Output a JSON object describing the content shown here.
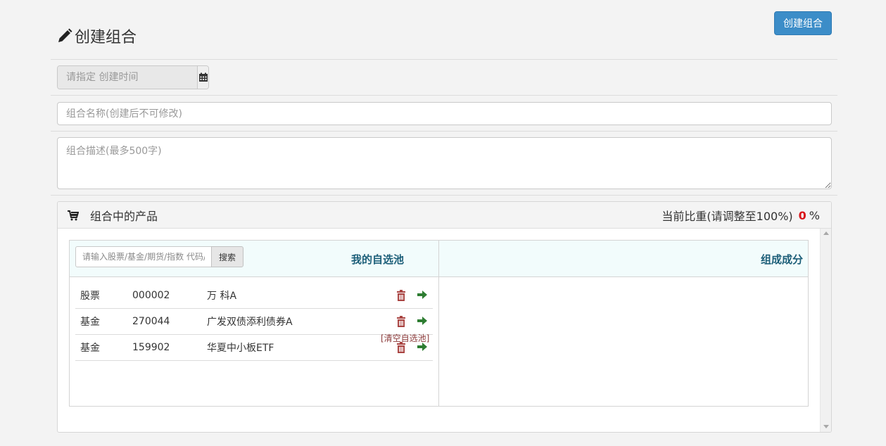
{
  "header": {
    "title": "创建组合",
    "create_button": "创建组合"
  },
  "form": {
    "date_placeholder": "请指定 创建时间",
    "name_placeholder": "组合名称(创建后不可修改)",
    "desc_placeholder": "组合描述(最多500字)"
  },
  "panel": {
    "title": "组合中的产品",
    "ratio_label": "当前比重(请调整至100%)",
    "ratio_value": "0",
    "ratio_unit": "%",
    "search_placeholder": "请输入股票/基金/期货/指数 代码/",
    "search_button": "搜索",
    "pool_title": "我的自选池",
    "composition_title": "组成成分",
    "clear_link": "[清空自选池]",
    "items": [
      {
        "type": "股票",
        "code": "000002",
        "name": "万 科A"
      },
      {
        "type": "基金",
        "code": "270044",
        "name": "广发双债添利债券A"
      },
      {
        "type": "基金",
        "code": "159902",
        "name": "华夏中小板ETF"
      }
    ]
  },
  "colors": {
    "primary_button": "#3c8dc8",
    "heading_teal": "#1d5f79",
    "ratio_red": "#d9141a",
    "trash_red": "#a94442",
    "arrow_green": "#2e7d32"
  },
  "icons": [
    "pencil-icon",
    "calendar-icon",
    "cart-icon",
    "trash-icon",
    "arrow-right-icon"
  ]
}
